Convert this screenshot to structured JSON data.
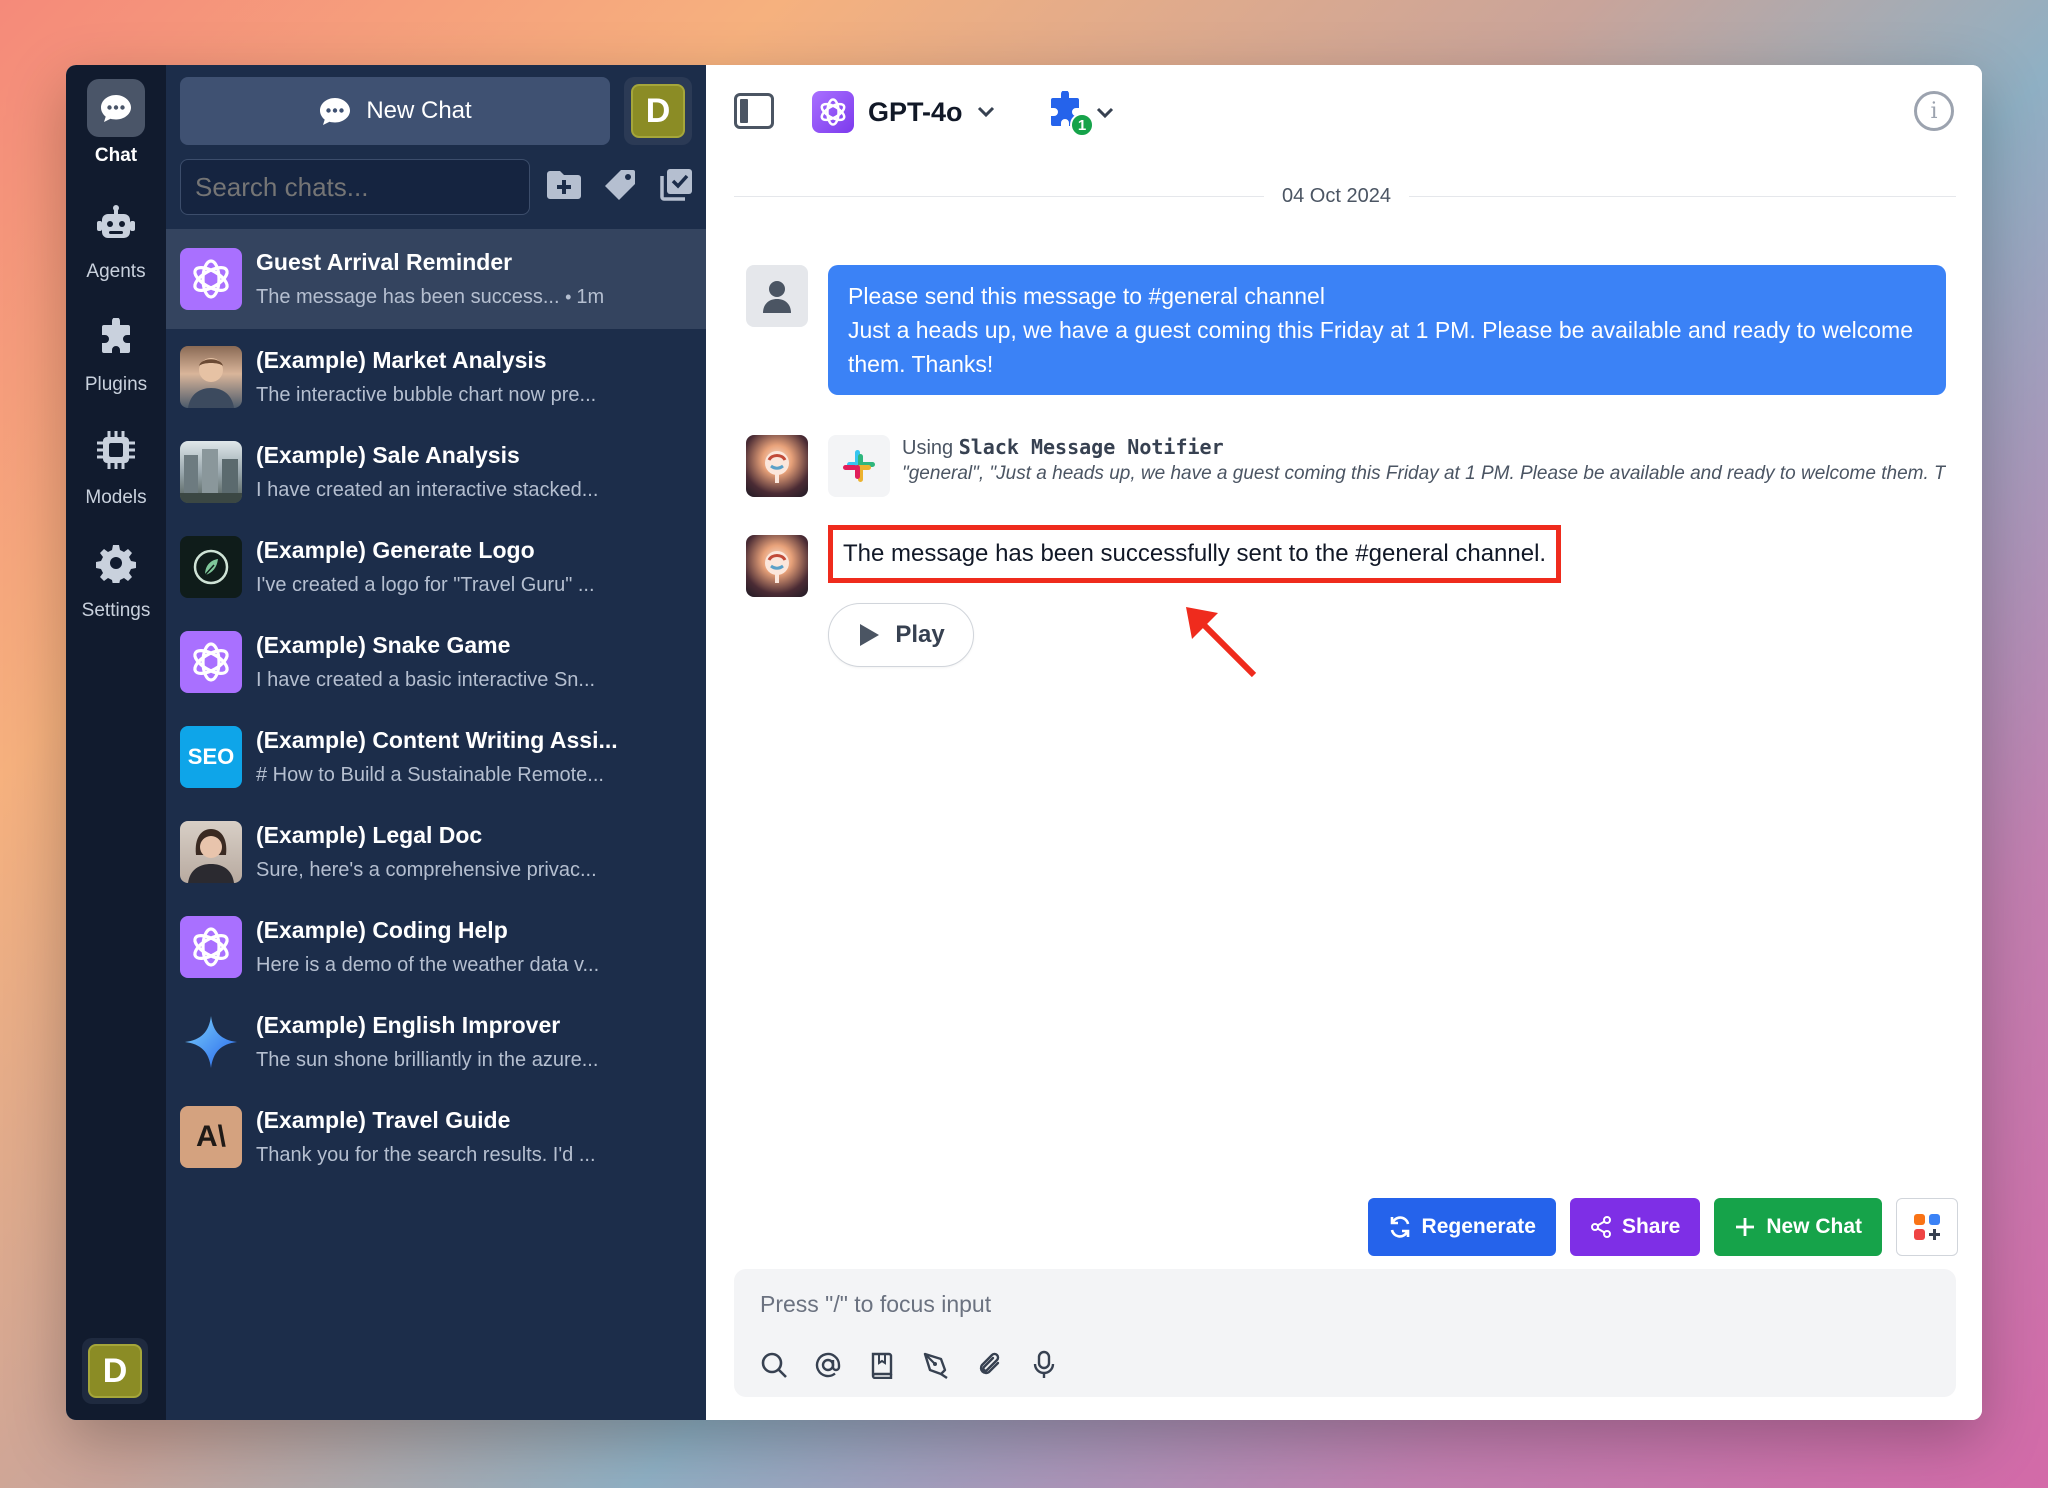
{
  "rail": {
    "items": [
      {
        "label": "Chat"
      },
      {
        "label": "Agents"
      },
      {
        "label": "Plugins"
      },
      {
        "label": "Models"
      },
      {
        "label": "Settings"
      }
    ],
    "user_initial": "D"
  },
  "sidebar": {
    "new_chat_label": "New Chat",
    "user_initial": "D",
    "search_placeholder": "Search chats...",
    "chats": [
      {
        "title": "Guest Arrival Reminder",
        "preview": "The message has been success...",
        "time": "1m"
      },
      {
        "title": "(Example) Market Analysis",
        "preview": "The interactive bubble chart now pre..."
      },
      {
        "title": "(Example) Sale Analysis",
        "preview": "I have created an interactive stacked..."
      },
      {
        "title": "(Example) Generate Logo",
        "preview": "I've created a logo for \"Travel Guru\" ..."
      },
      {
        "title": "(Example) Snake Game",
        "preview": "I have created a basic interactive Sn..."
      },
      {
        "title": "(Example) Content Writing Assi...",
        "preview": "# How to Build a Sustainable Remote..."
      },
      {
        "title": "(Example) Legal Doc",
        "preview": "Sure, here's a comprehensive privac..."
      },
      {
        "title": "(Example) Coding Help",
        "preview": "Here is a demo of the weather data v..."
      },
      {
        "title": "(Example) English Improver",
        "preview": "The sun shone brilliantly in the azure..."
      },
      {
        "title": "(Example) Travel Guide",
        "preview": "Thank you for the search results. I'd ..."
      }
    ],
    "seo_label": "SEO",
    "anthropic_label": "A\\"
  },
  "header": {
    "model_name": "GPT-4o",
    "plugin_count": "1",
    "info_glyph": "i"
  },
  "conversation": {
    "date": "04 Oct 2024",
    "user_message_line1": "Please send this message to #general channel",
    "user_message_line2": "Just a heads up, we have a guest coming this Friday at 1 PM. Please be available and ready to welcome them. Thanks!",
    "tool_using_prefix": "Using",
    "tool_name": "Slack Message Notifier",
    "tool_args": "\"general\", \"Just a heads up, we have a guest coming this Friday at 1 PM. Please be available and ready to welcome them. Thanks!\"",
    "assistant_reply": "The message has been successfully sent to the #general channel.",
    "play_label": "Play"
  },
  "actions": {
    "regenerate": "Regenerate",
    "share": "Share",
    "new_chat": "New Chat"
  },
  "composer": {
    "placeholder": "Press \"/\" to focus input"
  },
  "colors": {
    "accent_blue": "#3b82f6",
    "highlight_red": "#ef2b1d",
    "sidebar_bg": "#1c2d4a",
    "rail_bg": "#111b2e"
  }
}
